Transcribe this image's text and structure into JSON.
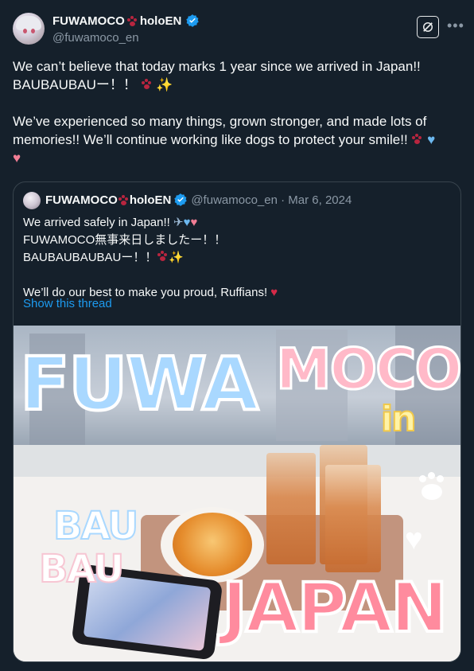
{
  "author": {
    "name": "FUWAMOCO",
    "name_suffix": "holoEN",
    "handle": "@fuwamoco_en"
  },
  "post": {
    "line1": "We can’t believe that today marks 1 year since we arrived in Japan!!",
    "line2": "BAUBAUBAUー！！",
    "line3": "We’ve experienced so many things, grown stronger, and made lots of memories!! We’ll continue working like dogs to protect your smile!!"
  },
  "quoted": {
    "name": "FUWAMOCO",
    "name_suffix": "holoEN",
    "meta": "@fuwamoco_en · Mar 6, 2024",
    "line1": "We arrived safely in Japan!!",
    "line2": "FUWAMOCO無事来日しましたー！！",
    "line3": "BAUBAUBAUBAUー！！",
    "line4": "We’ll do our best to make you proud, Ruffians!",
    "show_thread": "Show this thread"
  },
  "photo_text": {
    "word1": "FUWA",
    "word2": "MOCO",
    "word3": "in",
    "word4": "BAU",
    "word5": "BAU",
    "word6": "JAPAN"
  },
  "icons": [
    "paw-print-icon",
    "verified-badge-icon",
    "grok-icon",
    "more-icon",
    "sparkles-icon",
    "blue-heart-icon",
    "pink-heart-icon",
    "airplane-icon",
    "heart-with-ribbon-icon"
  ],
  "colors": {
    "background": "#15202b",
    "link": "#1d9bf0",
    "verified": "#1d9bf0",
    "muted": "#8b98a5"
  }
}
